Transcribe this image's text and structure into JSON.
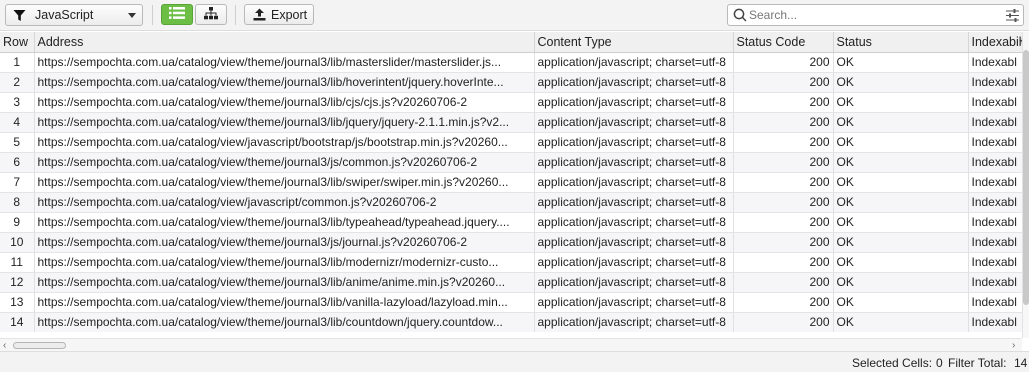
{
  "toolbar": {
    "filter": {
      "label": "JavaScript",
      "icon": "funnel-icon"
    },
    "view_list_icon": "list-view-icon",
    "view_tree_icon": "tree-view-icon",
    "export": {
      "label": "Export",
      "icon": "export-icon"
    },
    "search": {
      "placeholder": "Search...",
      "value": ""
    },
    "accent_color": "#6cbe45"
  },
  "table": {
    "columns": [
      "Row",
      "Address",
      "Content Type",
      "Status Code",
      "Status",
      "Indexabil"
    ],
    "rows": [
      {
        "row": "1",
        "address": "https://sempochta.com.ua/catalog/view/theme/journal3/lib/masterslider/masterslider.js...",
        "content_type": "application/javascript; charset=utf-8",
        "status_code": "200",
        "status": "OK",
        "indexability": "Indexabl"
      },
      {
        "row": "2",
        "address": "https://sempochta.com.ua/catalog/view/theme/journal3/lib/hoverintent/jquery.hoverInte...",
        "content_type": "application/javascript; charset=utf-8",
        "status_code": "200",
        "status": "OK",
        "indexability": "Indexabl"
      },
      {
        "row": "3",
        "address": "https://sempochta.com.ua/catalog/view/theme/journal3/lib/cjs/cjs.js?v20260706-2",
        "content_type": "application/javascript; charset=utf-8",
        "status_code": "200",
        "status": "OK",
        "indexability": "Indexabl"
      },
      {
        "row": "4",
        "address": "https://sempochta.com.ua/catalog/view/theme/journal3/lib/jquery/jquery-2.1.1.min.js?v2...",
        "content_type": "application/javascript; charset=utf-8",
        "status_code": "200",
        "status": "OK",
        "indexability": "Indexabl"
      },
      {
        "row": "5",
        "address": "https://sempochta.com.ua/catalog/view/javascript/bootstrap/js/bootstrap.min.js?v20260...",
        "content_type": "application/javascript; charset=utf-8",
        "status_code": "200",
        "status": "OK",
        "indexability": "Indexabl"
      },
      {
        "row": "6",
        "address": "https://sempochta.com.ua/catalog/view/theme/journal3/js/common.js?v20260706-2",
        "content_type": "application/javascript; charset=utf-8",
        "status_code": "200",
        "status": "OK",
        "indexability": "Indexabl"
      },
      {
        "row": "7",
        "address": "https://sempochta.com.ua/catalog/view/theme/journal3/lib/swiper/swiper.min.js?v20260...",
        "content_type": "application/javascript; charset=utf-8",
        "status_code": "200",
        "status": "OK",
        "indexability": "Indexabl"
      },
      {
        "row": "8",
        "address": "https://sempochta.com.ua/catalog/view/javascript/common.js?v20260706-2",
        "content_type": "application/javascript; charset=utf-8",
        "status_code": "200",
        "status": "OK",
        "indexability": "Indexabl"
      },
      {
        "row": "9",
        "address": "https://sempochta.com.ua/catalog/view/theme/journal3/lib/typeahead/typeahead.jquery....",
        "content_type": "application/javascript; charset=utf-8",
        "status_code": "200",
        "status": "OK",
        "indexability": "Indexabl"
      },
      {
        "row": "10",
        "address": "https://sempochta.com.ua/catalog/view/theme/journal3/js/journal.js?v20260706-2",
        "content_type": "application/javascript; charset=utf-8",
        "status_code": "200",
        "status": "OK",
        "indexability": "Indexabl"
      },
      {
        "row": "11",
        "address": "https://sempochta.com.ua/catalog/view/theme/journal3/lib/modernizr/modernizr-custo...",
        "content_type": "application/javascript; charset=utf-8",
        "status_code": "200",
        "status": "OK",
        "indexability": "Indexabl"
      },
      {
        "row": "12",
        "address": "https://sempochta.com.ua/catalog/view/theme/journal3/lib/anime/anime.min.js?v20260...",
        "content_type": "application/javascript; charset=utf-8",
        "status_code": "200",
        "status": "OK",
        "indexability": "Indexabl"
      },
      {
        "row": "13",
        "address": "https://sempochta.com.ua/catalog/view/theme/journal3/lib/vanilla-lazyload/lazyload.min...",
        "content_type": "application/javascript; charset=utf-8",
        "status_code": "200",
        "status": "OK",
        "indexability": "Indexabl"
      },
      {
        "row": "14",
        "address": "https://sempochta.com.ua/catalog/view/theme/journal3/lib/countdown/jquery.countdow...",
        "content_type": "application/javascript; charset=utf-8",
        "status_code": "200",
        "status": "OK",
        "indexability": "Indexabl"
      }
    ]
  },
  "status_bar": {
    "selected_label": "Selected Cells:",
    "selected_value": "0",
    "filter_label": "Filter Total:",
    "filter_value": "14"
  },
  "scroll_icons": {
    "left": "chevron-left-icon",
    "right": "chevron-right-icon",
    "add_column": "plus-icon"
  },
  "corner_add_column": "+",
  "scroll_arrows": {
    "left": "‹",
    "right": "›"
  }
}
